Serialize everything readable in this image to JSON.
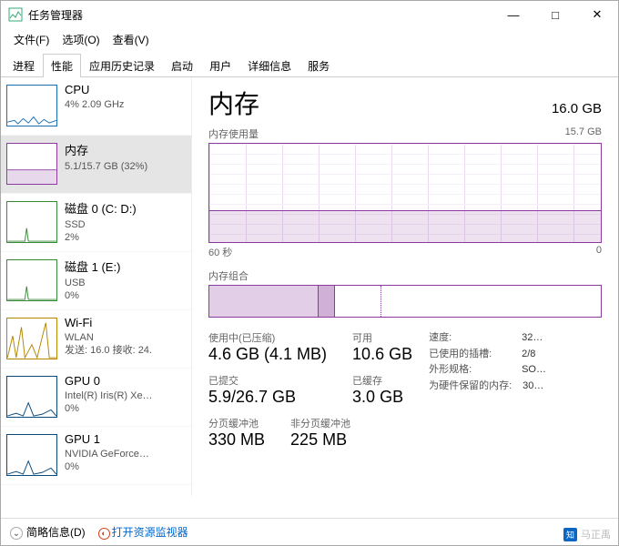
{
  "window": {
    "title": "任务管理器",
    "controls": {
      "min": "—",
      "max": "□",
      "close": "✕"
    }
  },
  "menu": {
    "file": "文件(F)",
    "options": "选项(O)",
    "view": "查看(V)"
  },
  "tabs": [
    "进程",
    "性能",
    "应用历史记录",
    "启动",
    "用户",
    "详细信息",
    "服务"
  ],
  "activeTab": 1,
  "sidebar": [
    {
      "kind": "cpu",
      "title": "CPU",
      "line1": "4% 2.09 GHz",
      "line2": ""
    },
    {
      "kind": "mem",
      "title": "内存",
      "line1": "5.1/15.7 GB (32%)",
      "line2": ""
    },
    {
      "kind": "disk",
      "title": "磁盘 0 (C: D:)",
      "line1": "SSD",
      "line2": "2%"
    },
    {
      "kind": "disk",
      "title": "磁盘 1 (E:)",
      "line1": "USB",
      "line2": "0%"
    },
    {
      "kind": "net",
      "title": "Wi-Fi",
      "line1": "WLAN",
      "line2": "发送: 16.0 接收: 24."
    },
    {
      "kind": "gpu",
      "title": "GPU 0",
      "line1": "Intel(R) Iris(R) Xe…",
      "line2": "0%"
    },
    {
      "kind": "gpu",
      "title": "GPU 1",
      "line1": "NVIDIA GeForce…",
      "line2": "0%"
    }
  ],
  "activeSidebar": 1,
  "main": {
    "title": "内存",
    "total": "16.0 GB",
    "usageLabel": "内存使用量",
    "usageMax": "15.7 GB",
    "xLeft": "60 秒",
    "xRight": "0",
    "compLabel": "内存组合",
    "stats": {
      "inUseLabel": "使用中(已压缩)",
      "inUse": "4.6 GB (4.1 MB)",
      "availLabel": "可用",
      "avail": "10.6 GB",
      "commitLabel": "已提交",
      "commit": "5.9/26.7 GB",
      "cachedLabel": "已缓存",
      "cached": "3.0 GB",
      "pagedLabel": "分页缓冲池",
      "paged": "330 MB",
      "nonpagedLabel": "非分页缓冲池",
      "nonpaged": "225 MB"
    },
    "right": [
      {
        "k": "速度:",
        "v": "32…"
      },
      {
        "k": "已使用的插槽:",
        "v": "2/8"
      },
      {
        "k": "外形规格:",
        "v": "SO…"
      },
      {
        "k": "为硬件保留的内存:",
        "v": "30…"
      }
    ]
  },
  "statusbar": {
    "brief": "简略信息(D)",
    "resmon": "打开资源监视器"
  },
  "watermark": "马正禹",
  "chart_data": {
    "type": "area",
    "title": "内存使用量",
    "ylabel": "GB",
    "ylim": [
      0,
      15.7
    ],
    "xlabel": "秒",
    "xlim": [
      60,
      0
    ],
    "series": [
      {
        "name": "内存使用量",
        "values": [
          5.1,
          5.1,
          5.1,
          5.1,
          5.1,
          5.1,
          5.1,
          5.1,
          5.1,
          5.1,
          5.1,
          5.1,
          5.1,
          5.1,
          5.1,
          5.1,
          5.1,
          5.1,
          5.1,
          5.1,
          5.1,
          5.1,
          5.1,
          5.1,
          5.1,
          5.1,
          5.1,
          5.1,
          5.1,
          5.1
        ],
        "unit": "GB"
      }
    ],
    "composition": {
      "type": "bar",
      "total_gb": 15.7,
      "segments": [
        {
          "name": "使用中",
          "value_gb": 4.6
        },
        {
          "name": "已压缩",
          "value_mb": 4.1
        },
        {
          "name": "已缓存",
          "value_gb": 3.0
        },
        {
          "name": "可用",
          "value_gb": 10.6
        }
      ]
    }
  }
}
